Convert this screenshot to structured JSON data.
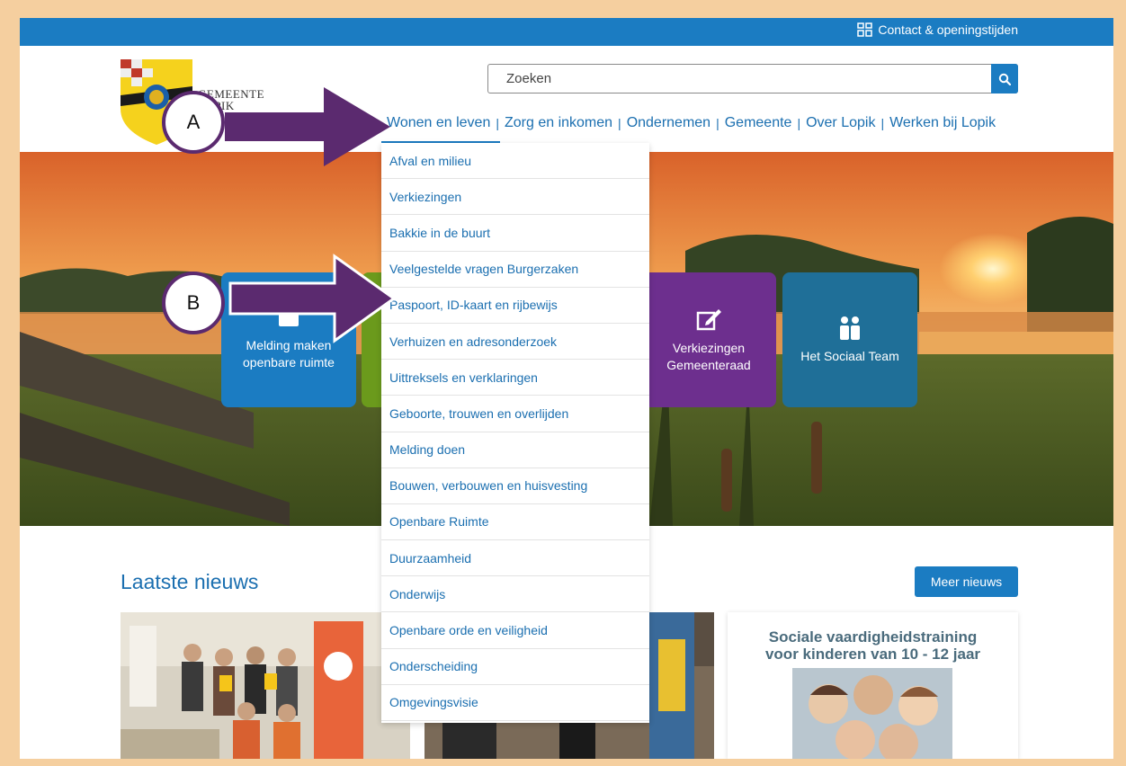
{
  "topbar": {
    "contact_label": "Contact & openingstijden",
    "contact_icon": "contact-icon"
  },
  "logo": {
    "text": "GEMEENTE LOPIK"
  },
  "search": {
    "placeholder": "Zoeken",
    "icon": "search-icon"
  },
  "nav": {
    "items": [
      "Wonen en leven",
      "Zorg en inkomen",
      "Ondernemen",
      "Gemeente",
      "Over Lopik",
      "Werken bij Lopik"
    ],
    "active": "Wonen en leven"
  },
  "dropdown": {
    "items": [
      "Afval en milieu",
      "Verkiezingen",
      "Bakkie in de buurt",
      "Veelgestelde vragen Burgerzaken",
      "Paspoort, ID-kaart en rijbewijs",
      "Verhuizen en adresonderzoek",
      "Uittreksels en verklaringen",
      "Geboorte, trouwen en overlijden",
      "Melding doen",
      "Bouwen, verbouwen en huisvesting",
      "Openbare Ruimte",
      "Duurzaamheid",
      "Onderwijs",
      "Openbare orde en veiligheid",
      "Onderscheiding",
      "Omgevingsvisie"
    ]
  },
  "tiles": {
    "melding": {
      "line1": "Melding maken",
      "line2": "openbare ruimte",
      "color": "#1b7cc2"
    },
    "verkiezingen": {
      "line1": "Verkiezingen",
      "line2": "Gemeenteraad",
      "color": "#6d2f8e"
    },
    "sociaal": {
      "label": "Het Sociaal Team",
      "color": "#1f6f98"
    },
    "green": {
      "color": "#6b9a1c"
    }
  },
  "news": {
    "title": "Laatste nieuws",
    "more_label": "Meer nieuws",
    "card3_title_line1": "Sociale vaardigheidstraining",
    "card3_title_line2": "voor kinderen van 10 - 12 jaar"
  },
  "annotations": {
    "a": "A",
    "b": "B",
    "color": "#5b2a6f"
  },
  "colors": {
    "brand_blue": "#1b7cc2",
    "page_border": "#f5cf9f"
  }
}
